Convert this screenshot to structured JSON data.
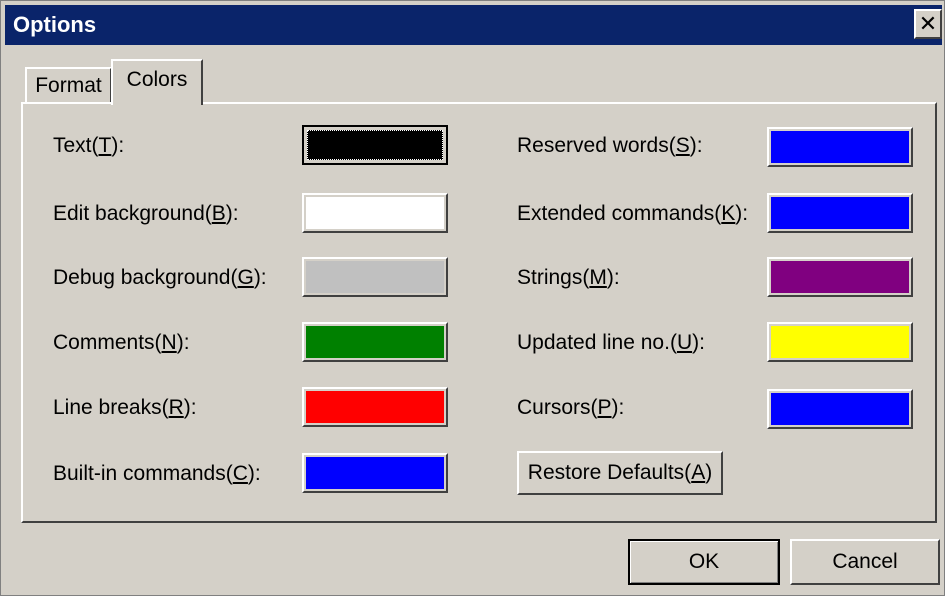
{
  "window": {
    "title": "Options",
    "close_glyph": "✕"
  },
  "tabs": [
    {
      "label": "Format",
      "selected": false
    },
    {
      "label": "Colors",
      "selected": true
    }
  ],
  "colors_left": [
    {
      "label": "Text(T):",
      "color": "#000000",
      "focused": true
    },
    {
      "label": "Edit background(B):",
      "color": "#ffffff"
    },
    {
      "label": "Debug background(G):",
      "color": "#c0c0c0"
    },
    {
      "label": "Comments(N):",
      "color": "#008000"
    },
    {
      "label": "Line breaks(R):",
      "color": "#ff0000"
    },
    {
      "label": "Built-in commands(C):",
      "color": "#0000ff"
    }
  ],
  "colors_right": [
    {
      "label": "Reserved words(S):",
      "color": "#0000ff"
    },
    {
      "label": "Extended commands(K):",
      "color": "#0000ff"
    },
    {
      "label": "Strings(M):",
      "color": "#800080"
    },
    {
      "label": "Updated line no.(U):",
      "color": "#ffff00"
    },
    {
      "label": "Cursors(P):",
      "color": "#0000ff"
    }
  ],
  "restore_defaults_label": "Restore Defaults(A)",
  "buttons": {
    "ok_label": "OK",
    "cancel_label": "Cancel"
  }
}
